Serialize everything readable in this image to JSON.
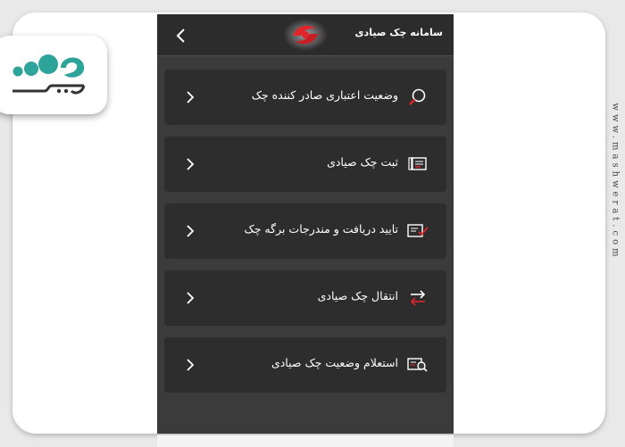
{
  "colors": {
    "phone_background": "#3b3b3b",
    "card_background": "#2d2d2d",
    "header_background": "#2c2c2c",
    "accent_red": "#e0262b",
    "brand_teal": "#2ea39a"
  },
  "header": {
    "title": "سامانه چک صیادی",
    "back_icon": "chevron-left-icon",
    "logo": "sayad-red-logo"
  },
  "menu": {
    "items": [
      {
        "label": "وضعیت اعتباری صادر کننده چک",
        "icon": "magnifier-icon"
      },
      {
        "label": "ثبت چک صیادی",
        "icon": "cheque-register-icon"
      },
      {
        "label": "تایید دریافت و مندرجات برگه چک",
        "icon": "checklist-icon"
      },
      {
        "label": "انتقال چک صیادی",
        "icon": "transfer-arrows-icon"
      },
      {
        "label": "استعلام وضعیت چک صیادی",
        "icon": "inquiry-icon"
      }
    ]
  },
  "watermark": {
    "brand_text": "مشورت",
    "site_url": "www.mashwerat.com"
  }
}
